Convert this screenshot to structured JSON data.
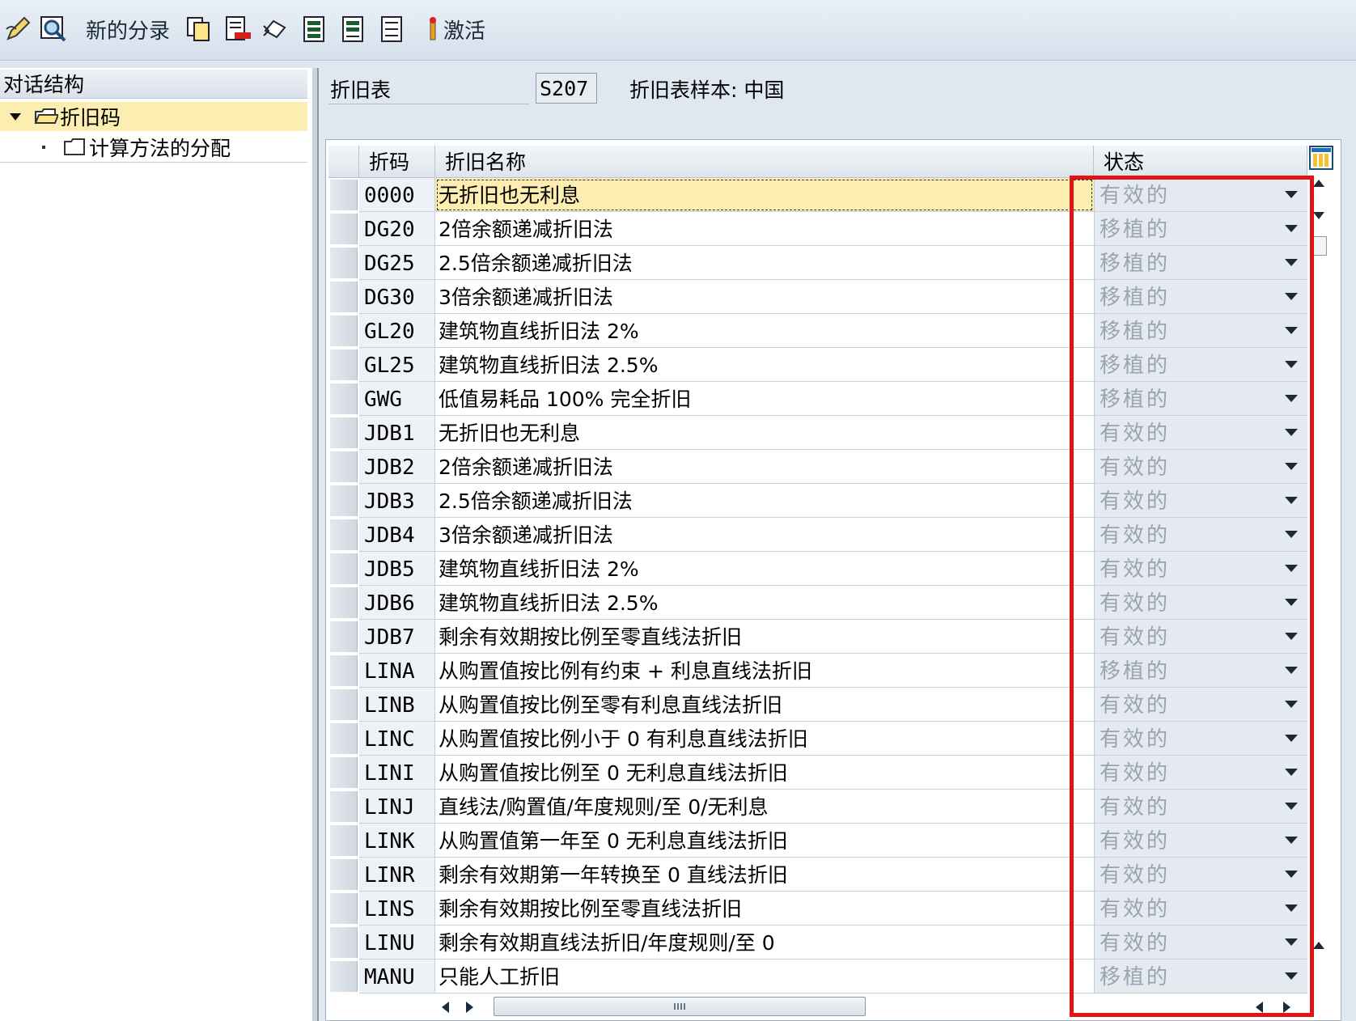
{
  "toolbar": {
    "new_entries_label": "新的分录",
    "activate_label": "激活",
    "icons": [
      "edit-pen-icon",
      "display-change-icon",
      "copy-icon",
      "delete-icon",
      "undo-icon",
      "select-all-icon",
      "select-block-icon",
      "deselect-all-icon",
      "activate-icon"
    ]
  },
  "tree": {
    "header": "对话结构",
    "items": [
      {
        "label": "折旧码",
        "icon": "open-folder-icon",
        "expanded": true,
        "selected": true
      },
      {
        "label": "计算方法的分配",
        "icon": "folder-icon",
        "selected": false
      }
    ]
  },
  "form": {
    "chart_label": "折旧表",
    "chart_value": "S207",
    "chart_desc": "折旧表样本: 中国"
  },
  "table": {
    "columns": [
      "折码",
      "折旧名称",
      "状态"
    ],
    "rows": [
      {
        "code": "0000",
        "name": "无折旧也无利息",
        "status": "有效的"
      },
      {
        "code": "DG20",
        "name": "2倍余额递减折旧法",
        "status": "移植的"
      },
      {
        "code": "DG25",
        "name": "2.5倍余额递减折旧法",
        "status": "移植的"
      },
      {
        "code": "DG30",
        "name": "3倍余额递减折旧法",
        "status": "移植的"
      },
      {
        "code": "GL20",
        "name": "建筑物直线折旧法 2%",
        "status": "移植的"
      },
      {
        "code": "GL25",
        "name": "建筑物直线折旧法 2.5%",
        "status": "移植的"
      },
      {
        "code": "GWG",
        "name": "低值易耗品 100% 完全折旧",
        "status": "移植的"
      },
      {
        "code": "JDB1",
        "name": "无折旧也无利息",
        "status": "有效的"
      },
      {
        "code": "JDB2",
        "name": "2倍余额递减折旧法",
        "status": "有效的"
      },
      {
        "code": "JDB3",
        "name": "2.5倍余额递减折旧法",
        "status": "有效的"
      },
      {
        "code": "JDB4",
        "name": "3倍余额递减折旧法",
        "status": "有效的"
      },
      {
        "code": "JDB5",
        "name": "建筑物直线折旧法 2%",
        "status": "有效的"
      },
      {
        "code": "JDB6",
        "name": "建筑物直线折旧法 2.5%",
        "status": "有效的"
      },
      {
        "code": "JDB7",
        "name": "剩余有效期按比例至零直线法折旧",
        "status": "有效的"
      },
      {
        "code": "LINA",
        "name": "从购置值按比例有约束 + 利息直线法折旧",
        "status": "移植的"
      },
      {
        "code": "LINB",
        "name": "从购置值按比例至零有利息直线法折旧",
        "status": "有效的"
      },
      {
        "code": "LINC",
        "name": "从购置值按比例小于 0 有利息直线法折旧",
        "status": "有效的"
      },
      {
        "code": "LINI",
        "name": "从购置值按比例至 0 无利息直线法折旧",
        "status": "有效的"
      },
      {
        "code": "LINJ",
        "name": "直线法/购置值/年度规则/至 0/无利息",
        "status": "有效的"
      },
      {
        "code": "LINK",
        "name": "从购置值第一年至 0 无利息直线法折旧",
        "status": "有效的"
      },
      {
        "code": "LINR",
        "name": "剩余有效期第一年转换至 0 直线法折旧",
        "status": "有效的"
      },
      {
        "code": "LINS",
        "name": "剩余有效期按比例至零直线法折旧",
        "status": "有效的"
      },
      {
        "code": "LINU",
        "name": "剩余有效期直线法折旧/年度规则/至 0",
        "status": "有效的"
      },
      {
        "code": "MANU",
        "name": "只能人工折旧",
        "status": "移植的"
      }
    ]
  },
  "highlight_color": "#e01414"
}
